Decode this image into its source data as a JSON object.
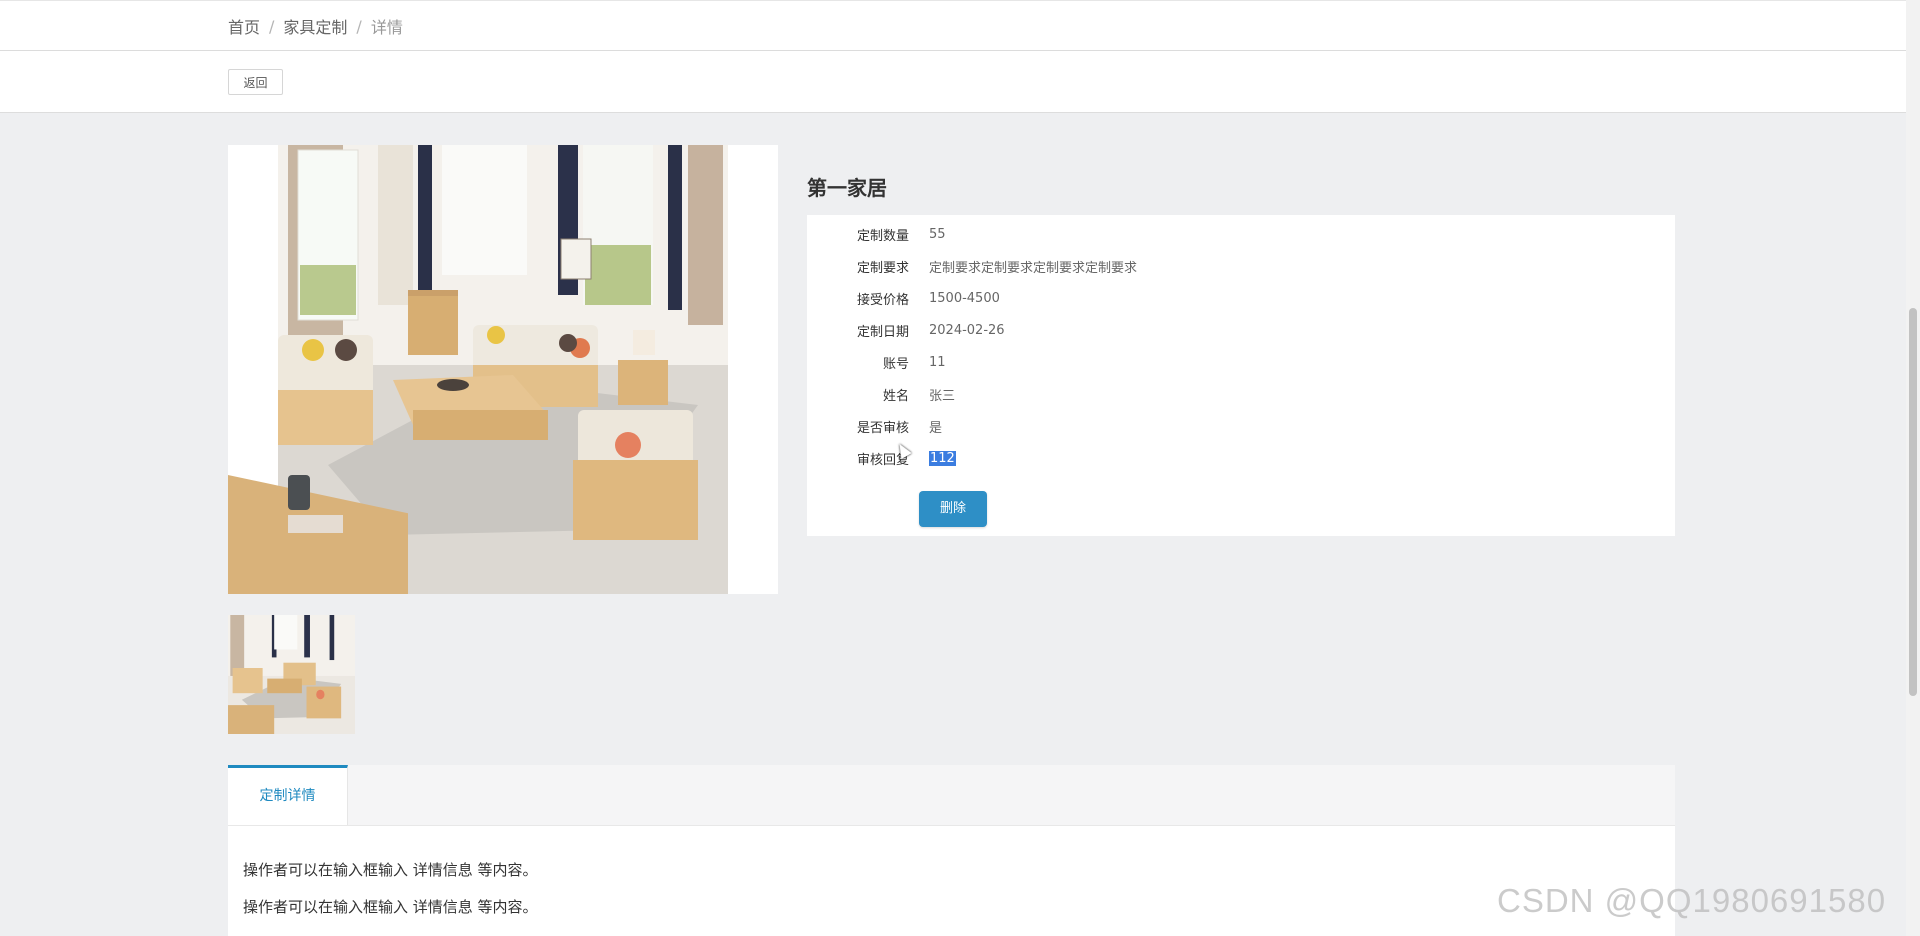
{
  "breadcrumb": {
    "home": "首页",
    "category": "家具定制",
    "current": "详情",
    "separator": "/"
  },
  "toolbar": {
    "back_label": "返回"
  },
  "product": {
    "title": "第一家居",
    "fields": [
      {
        "label": "定制数量",
        "value": "55"
      },
      {
        "label": "定制要求",
        "value": "定制要求定制要求定制要求定制要求"
      },
      {
        "label": "接受价格",
        "value": "1500-4500"
      },
      {
        "label": "定制日期",
        "value": "2024-02-26"
      },
      {
        "label": "账号",
        "value": "11"
      },
      {
        "label": "姓名",
        "value": "张三"
      },
      {
        "label": "是否审核",
        "value": "是"
      },
      {
        "label": "审核回复",
        "value": "112"
      }
    ],
    "delete_label": "删除"
  },
  "tabs": [
    {
      "label": "定制详情"
    }
  ],
  "detail": {
    "lines": [
      "操作者可以在输入框输入  详情信息  等内容。",
      "操作者可以在输入框输入  详情信息  等内容。"
    ]
  },
  "watermark": "CSDN @QQ1980691580",
  "colors": {
    "accent": "#1f8ac0",
    "button": "#2e8fc6",
    "page_bg": "#eeeff1",
    "selection": "#3b7de0"
  },
  "icons": {
    "cursor": "mouse-pointer-icon"
  }
}
